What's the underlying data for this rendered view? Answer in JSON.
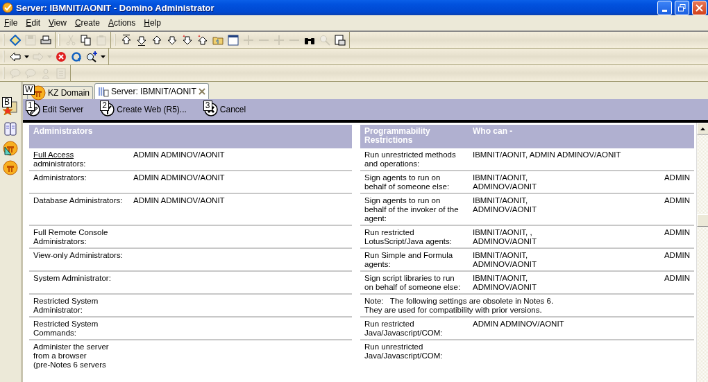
{
  "window": {
    "title": "Server: IBMNIT/AONIT - Domino Administrator"
  },
  "menu": [
    {
      "key": "F",
      "rest": "ile"
    },
    {
      "key": "E",
      "rest": "dit"
    },
    {
      "key": "V",
      "rest": "iew"
    },
    {
      "key": "C",
      "rest": "reate"
    },
    {
      "key": "A",
      "rest": "ctions"
    },
    {
      "key": "H",
      "rest": "elp"
    }
  ],
  "toolbars": [
    [
      [
        {
          "kind": "open",
          "disabled": false
        },
        {
          "kind": "save",
          "disabled": true
        },
        {
          "kind": "print",
          "disabled": false
        }
      ],
      [
        {
          "kind": "cut",
          "disabled": true
        },
        {
          "kind": "copy",
          "disabled": false
        },
        {
          "kind": "paste",
          "disabled": true
        }
      ],
      [
        {
          "kind": "top",
          "disabled": false
        },
        {
          "kind": "down-bar",
          "disabled": false
        },
        {
          "kind": "up",
          "disabled": false
        },
        {
          "kind": "down",
          "disabled": false
        },
        {
          "kind": "star-down",
          "disabled": false
        },
        {
          "kind": "star-up",
          "disabled": false
        },
        {
          "kind": "folder",
          "disabled": false
        },
        {
          "kind": "window",
          "disabled": false
        },
        {
          "kind": "plus",
          "disabled": true
        },
        {
          "kind": "minus",
          "disabled": true
        },
        {
          "kind": "plus",
          "disabled": true
        },
        {
          "kind": "minus",
          "disabled": true
        },
        {
          "kind": "binoculars",
          "disabled": false
        },
        {
          "kind": "search",
          "disabled": true
        },
        {
          "kind": "preview",
          "disabled": false
        }
      ]
    ],
    [
      [
        {
          "kind": "back",
          "disabled": false
        },
        {
          "kind": "caret",
          "disabled": false
        },
        {
          "kind": "forward",
          "disabled": true
        },
        {
          "kind": "caret",
          "disabled": true
        },
        {
          "kind": "stop",
          "disabled": false
        },
        {
          "kind": "refresh",
          "disabled": false
        },
        {
          "kind": "search-plus",
          "disabled": false
        },
        {
          "kind": "caret",
          "disabled": false
        }
      ]
    ],
    [
      [
        {
          "kind": "speech",
          "disabled": true
        },
        {
          "kind": "speech",
          "disabled": true
        },
        {
          "kind": "person",
          "disabled": true
        },
        {
          "kind": "document",
          "disabled": true
        }
      ]
    ]
  ],
  "sidebar": {
    "hotkey": "B"
  },
  "tabs": [
    {
      "label": "KZ Domain",
      "hotkey": "W",
      "selected": false
    },
    {
      "label": "Server: IBMNIT/AONIT",
      "selected": true
    }
  ],
  "actions": [
    {
      "hotkey": "1",
      "label": "Edit Server"
    },
    {
      "hotkey": "2",
      "label": "Create Web (R5)..."
    },
    {
      "hotkey": "3",
      "label": "Cancel"
    }
  ],
  "administrators": {
    "heading": "Administrators",
    "rows": [
      {
        "link": "Full Access",
        "label": "administrators:",
        "value": "ADMIN ADMINOV/AONIT"
      },
      {
        "label": "Administrators:",
        "value": "ADMIN ADMINOV/AONIT"
      },
      {
        "label": "Database Administrators:",
        "value": "ADMIN ADMINOV/AONIT"
      },
      {
        "label": "Full Remote Console\nAdministrators:"
      },
      {
        "label": "View-only Administrators:"
      },
      {
        "label": "System Administrator:"
      },
      {
        "label": "Restricted System\nAdministrator:"
      },
      {
        "label": "Restricted System\nCommands:"
      },
      {
        "label": "Administer the server\nfrom a browser\n(pre-Notes 6 servers"
      }
    ]
  },
  "programmability": {
    "heading": "Programmability\nRestrictions",
    "heading_2": "Who can -",
    "rows": [
      {
        "kind": "setting",
        "label": "Run unrestricted methods\nand operations:",
        "value": "IBMNIT/AONIT, ADMIN ADMINOV/AONIT"
      },
      {
        "kind": "setting",
        "label": "Sign agents to run on\nbehalf of someone else:",
        "value": "IBMNIT/AONIT,\nADMINOV/AONIT",
        "extra": "ADMIN"
      },
      {
        "kind": "setting",
        "label": "Sign agents to run on\nbehalf of the invoker of the\nagent:",
        "value": "IBMNIT/AONIT,\nADMINOV/AONIT",
        "extra": "ADMIN"
      },
      {
        "kind": "setting",
        "label": "Run restricted\nLotusScript/Java agents:",
        "value": "IBMNIT/AONIT, ,\nADMINOV/AONIT",
        "extra": "ADMIN"
      },
      {
        "kind": "setting",
        "label": "Run Simple and Formula\nagents:",
        "value": "IBMNIT/AONIT,\nADMINOV/AONIT",
        "extra": "ADMIN"
      },
      {
        "kind": "setting",
        "label": "Sign script libraries to run\non behalf of someone else:",
        "value": "IBMNIT/AONIT,\nADMINOV/AONIT",
        "extra": "ADMIN"
      },
      {
        "kind": "note",
        "text": "Note:   The following settings are obsolete in Notes 6.\nThey are used for compatibility with prior versions."
      },
      {
        "kind": "setting",
        "label": "Run restricted\nJava/Javascript/COM:",
        "value": "ADMIN ADMINOV/AONIT"
      },
      {
        "kind": "setting",
        "label": "Run unrestricted\nJava/Javascript/COM:"
      }
    ]
  }
}
